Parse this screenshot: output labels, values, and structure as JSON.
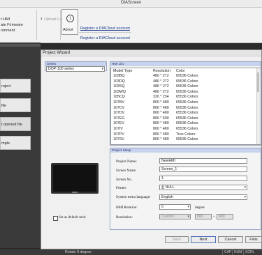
{
  "app": {
    "title": "DIAScreen"
  },
  "ribbon": {
    "new_hmi": "t HMI",
    "update_firmware": "ate Firmware",
    "environment": "ronment",
    "upload_logo_data": "Upload Logo Data",
    "about": "About",
    "register1": "Register a DIACloud account",
    "register2": "Register a DIACloud account"
  },
  "sidebar": {
    "items": [
      "roject",
      "file",
      "t opened file",
      "mple"
    ]
  },
  "dialog": {
    "title": "Project Wizard",
    "series_group": "Series",
    "series_value": "DOP-100 series",
    "list_group": "HMI List",
    "columns": [
      "Model Type",
      "Resolution",
      "Color"
    ],
    "rows": [
      [
        "103BQ",
        "480 * 272",
        "65536 Colors"
      ],
      [
        "103DQ",
        "480 * 272",
        "65536 Colors"
      ],
      [
        "103SQ",
        "480 * 272",
        "65536 Colors"
      ],
      [
        "103WQ",
        "480 * 272",
        "65536 Colors"
      ],
      [
        "105CQ",
        "320 * 234",
        "65536 Colors"
      ],
      [
        "107BV",
        "800 * 480",
        "65536 Colors"
      ],
      [
        "107CV",
        "800 * 480",
        "65536 Colors"
      ],
      [
        "107DV",
        "800 * 480",
        "65536 Colors"
      ],
      [
        "107EG",
        "800 * 600",
        "65536 Colors"
      ],
      [
        "107EV",
        "800 * 480",
        "65536 Colors"
      ],
      [
        "107IV",
        "800 * 480",
        "65536 Colors"
      ],
      [
        "107PV",
        "800 * 480",
        "True Colors"
      ],
      [
        "107SV",
        "800 * 480",
        "65536 Colors"
      ]
    ],
    "setup_group": "Project Setup",
    "project_name_label": "Project Name:",
    "project_name": "NewHMI",
    "screen_name_label": "Screen Name:",
    "screen_name": "Screen_1",
    "screen_no_label": "Screen No.",
    "screen_no": "1",
    "printer_label": "Printer:",
    "printer": "NULL",
    "language_label": "System menu language:",
    "language": "English",
    "rotation_label": "HMI Rotation:",
    "rotation": "0",
    "degree": "degree",
    "resolution_label": "Resolution:",
    "resolution_mode": "Custom",
    "res_w": "800",
    "res_x": "*",
    "res_h": "480",
    "default_model": "Set as default mod",
    "back": "Back",
    "next": "Next",
    "cancel": "Cancel",
    "finish": "Finis"
  },
  "status": {
    "text": "Rotate 0 degree",
    "cap": "CAP",
    "num": "NUM",
    "scrl": "SCRL"
  }
}
